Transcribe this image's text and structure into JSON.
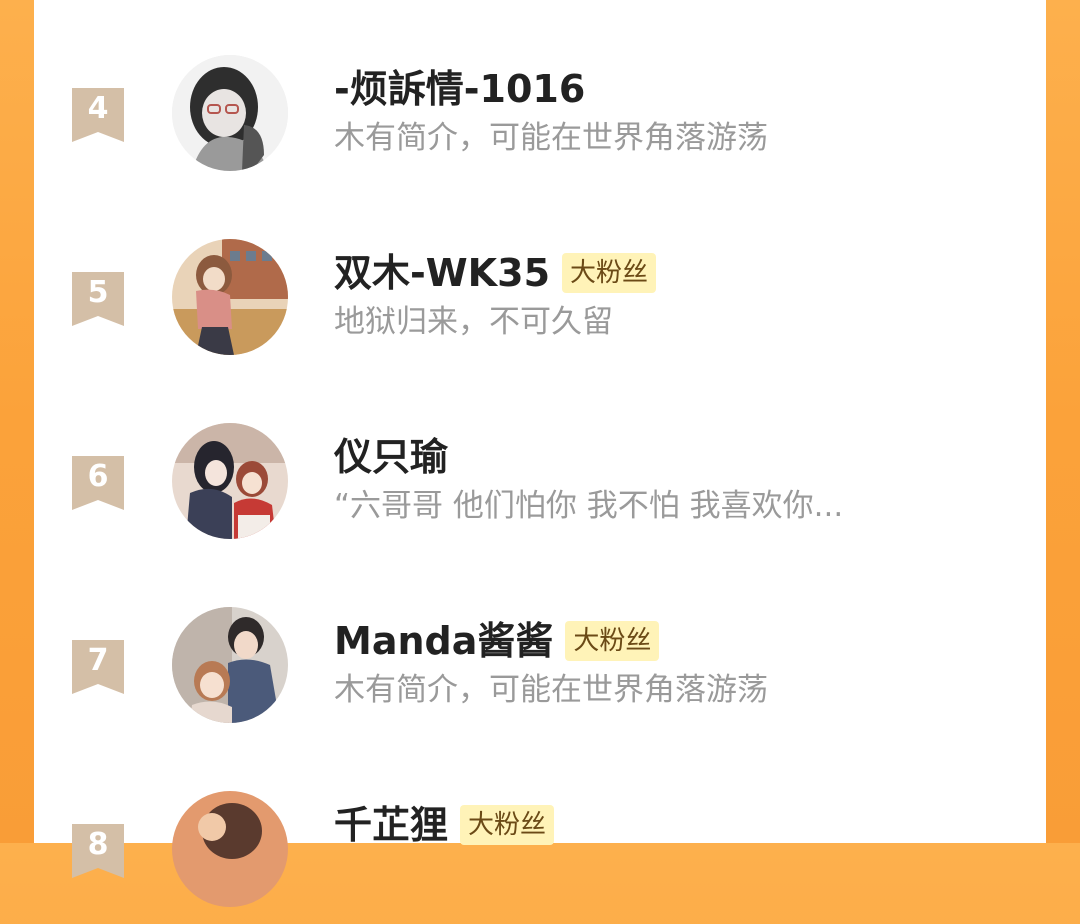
{
  "colors": {
    "background_orange": "#fba23a",
    "rank_badge": "#d4bfa7",
    "fan_badge_bg": "#fff3b8",
    "fan_badge_text": "#6b4a16",
    "name_text": "#222222",
    "bio_text": "#9a9a9a"
  },
  "list": [
    {
      "rank": "4",
      "name": "-烦訴情-1016",
      "badge": "",
      "bio": "木有简介，可能在世界角落游荡",
      "avatar": "avatar-grey-anime-girl-glasses"
    },
    {
      "rank": "5",
      "name": "双木-WK35",
      "badge": "大粉丝",
      "bio": "地狱归来，不可久留",
      "avatar": "avatar-anime-girl-autumn-street"
    },
    {
      "rank": "6",
      "name": "仪只瑜",
      "badge": "",
      "bio": "“六哥哥 他们怕你 我不怕 我喜欢你...",
      "avatar": "avatar-two-anime-characters"
    },
    {
      "rank": "7",
      "name": "Manda酱酱",
      "badge": "大粉丝",
      "bio": "木有简介，可能在世界角落游荡",
      "avatar": "avatar-anime-couple"
    },
    {
      "rank": "8",
      "name": "千芷狸",
      "badge": "大粉丝",
      "bio": "",
      "avatar": "avatar-anime-warm-tone"
    }
  ]
}
